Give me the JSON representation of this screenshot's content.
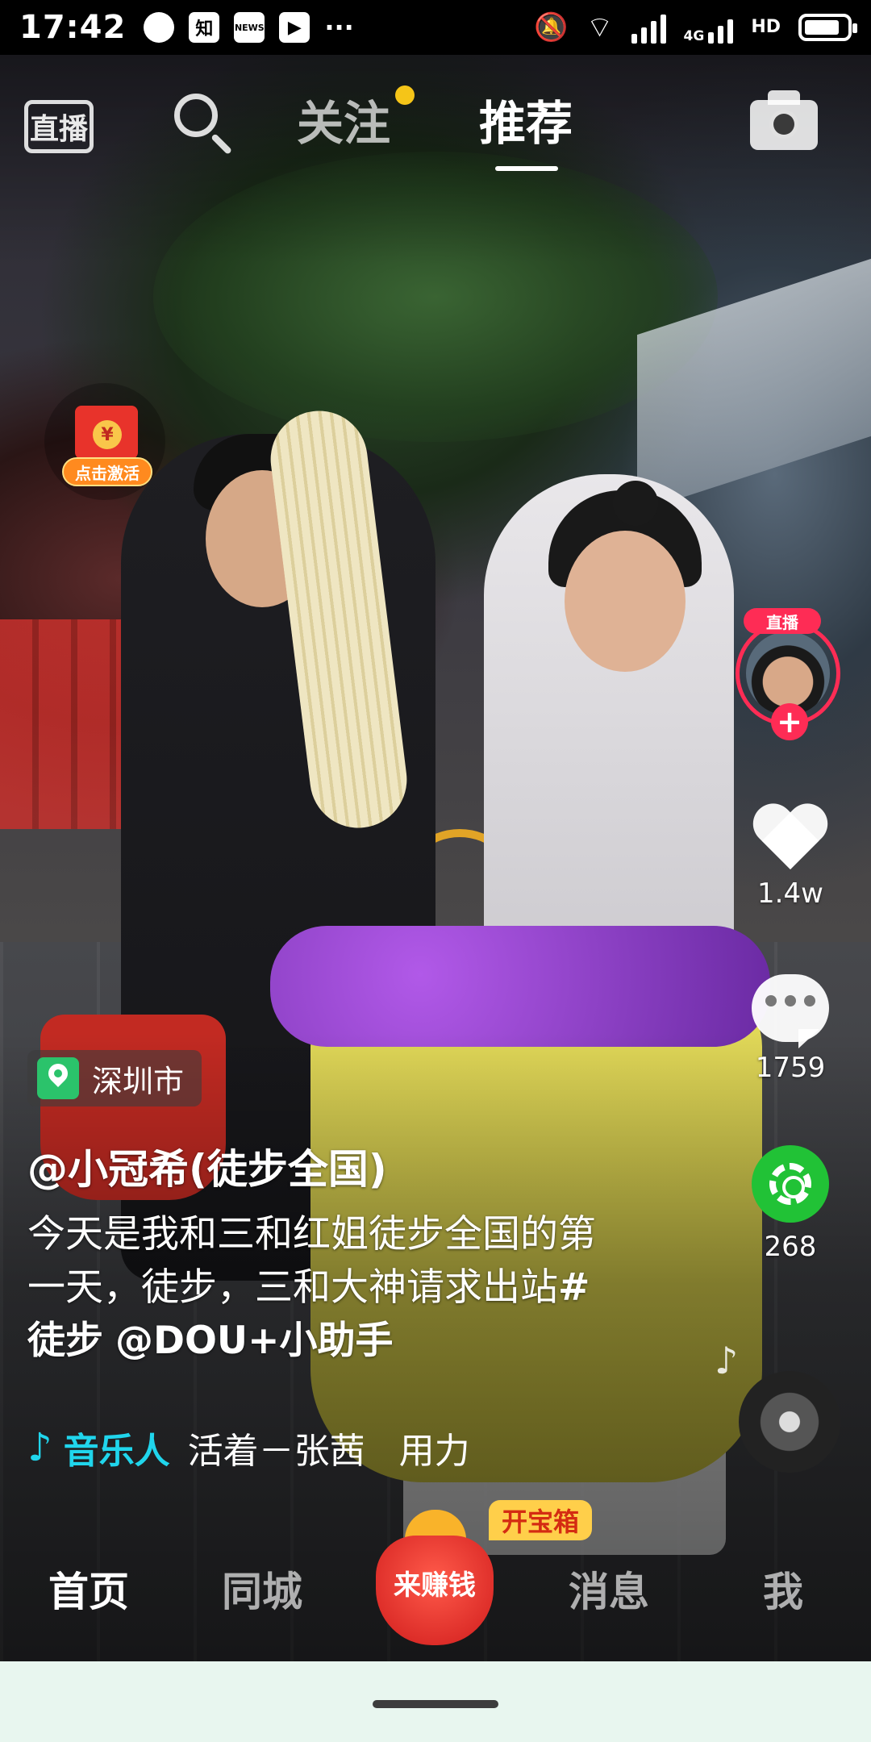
{
  "status_bar": {
    "time": "17:42",
    "app_icons": [
      "知",
      "NEWS"
    ],
    "network_label": "4G",
    "hd_label": "HD"
  },
  "top_nav": {
    "live_label": "直播",
    "tabs": [
      {
        "label": "关注",
        "has_dot": true,
        "active": false
      },
      {
        "label": "推荐",
        "active": true
      }
    ]
  },
  "red_packet": {
    "label": "点击激活",
    "coin_symbol": "¥"
  },
  "creator": {
    "live_badge": "直播",
    "follow_symbol": "+"
  },
  "actions": {
    "likes": "1.4w",
    "comments": "1759",
    "shares": "268"
  },
  "location": {
    "text": "深圳市"
  },
  "post": {
    "author": "@小冠希(徒步全国)",
    "caption_plain": "今天是我和三和红姐徒步全国的第一天，徒步，三和大神请求出站",
    "hashtag": "#徒步",
    "mention": "@DOU+小助手"
  },
  "music": {
    "tag": "音乐人",
    "title": "活着－张茜   用力"
  },
  "bottom_tabs": {
    "home": "首页",
    "nearby": "同城",
    "earn": "来赚钱",
    "earn_badge": "开宝箱",
    "messages": "消息",
    "me": "我"
  },
  "colors": {
    "accent_red": "#fe2c55",
    "follow_dot": "#f5c518",
    "music_cyan": "#20d5ec",
    "share_green": "#21c236",
    "location_green": "#2bc36b"
  }
}
